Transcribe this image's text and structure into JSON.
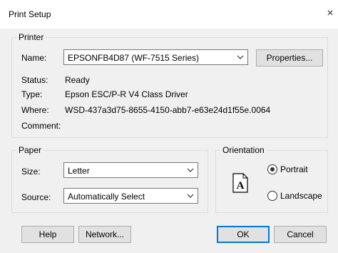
{
  "window": {
    "title": "Print Setup",
    "close_glyph": "×"
  },
  "printer": {
    "legend": "Printer",
    "name_label": "Name:",
    "name_value": "EPSONFB4D87 (WF-7515 Series)",
    "properties_button": "Properties...",
    "status_label": "Status:",
    "status_value": "Ready",
    "type_label": "Type:",
    "type_value": "Epson ESC/P-R V4 Class Driver",
    "where_label": "Where:",
    "where_value": "WSD-437a3d75-8655-4150-abb7-e63e24d1f55e.0064",
    "comment_label": "Comment:",
    "comment_value": ""
  },
  "paper": {
    "legend": "Paper",
    "size_label": "Size:",
    "size_value": "Letter",
    "source_label": "Source:",
    "source_value": "Automatically Select"
  },
  "orientation": {
    "legend": "Orientation",
    "preview_glyph": "A",
    "portrait_label": "Portrait",
    "landscape_label": "Landscape",
    "selected": "Portrait"
  },
  "buttons": {
    "help": "Help",
    "network": "Network...",
    "ok": "OK",
    "cancel": "Cancel"
  },
  "icons": {
    "close": "close-icon",
    "dropdown": "chevron-down-icon",
    "orientation_preview": "page-icon"
  },
  "colors": {
    "default_button_border": "#0078d7",
    "dialog_background": "#f0f0f0"
  }
}
